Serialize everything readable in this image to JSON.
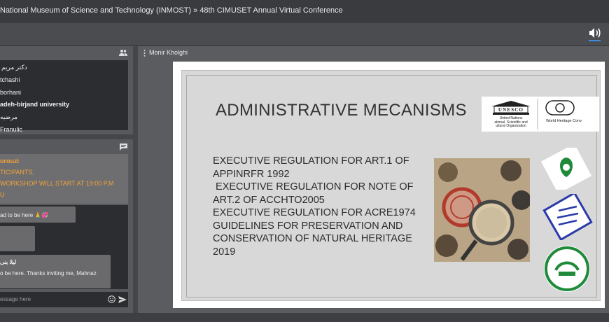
{
  "titlebar": {
    "breadcrumb": "National Museum of Science and Technology (INMOST) » 48th CIMUSET Annual Virtual Conference"
  },
  "users": [
    "دکتر مریم",
    "tchashi",
    "borhani",
    "adeh-birjand university",
    "مرضیه",
    "Franulic"
  ],
  "chat": {
    "announcement": [
      "orouzi",
      "TICIPANTS,",
      "WORKSHOP WILL START AT 19:00 P.M",
      "U"
    ],
    "messages": [
      {
        "text": "ad to be here 🙏💞"
      },
      {
        "text": ""
      },
      {
        "author": "لیلا بنی",
        "text": "o be here. Thanks inviting me, Mahnaz"
      }
    ],
    "placeholder": "essage here"
  },
  "stage": {
    "presenter": "Monir Kholghi"
  },
  "slide": {
    "title": "ADMINISTRATIVE MECANISMS",
    "lines": [
      "EXECUTIVE REGULATION FOR ART.1 OF",
      "APPINRFR 1992",
      " EXECUTIVE REGULATION FOR NOTE OF",
      "ART.2 OF ACCHTO2005",
      "EXECUTIVE REGULATION FOR ACRE1974",
      "GUIDELINES FOR PRESERVATION AND",
      "CONSERVATION OF NATURAL HERITAGE",
      "2019"
    ],
    "unesco": {
      "name": "UNESCO",
      "org": [
        "United Nations",
        "ational, Scientific and",
        "ultural Organization"
      ],
      "whc": "World Heritage Conv"
    }
  },
  "colors": {
    "accent": "#3b8fe0",
    "announcement_text": "#f2a23b"
  }
}
